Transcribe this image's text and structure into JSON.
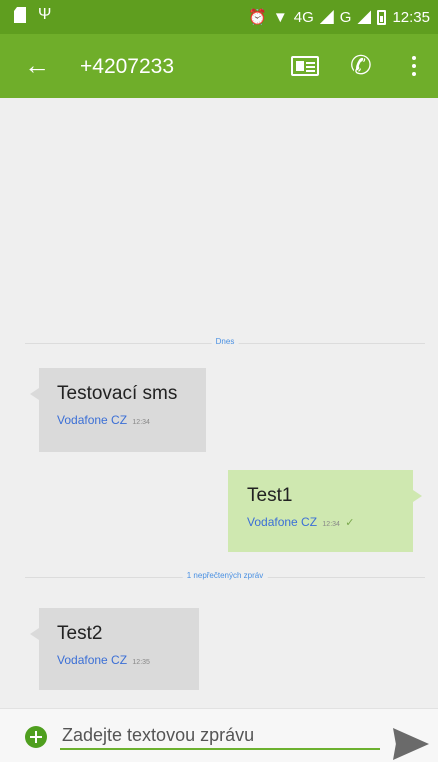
{
  "status_bar": {
    "time": "12:35",
    "network_1": "4G",
    "network_2": "G",
    "icons": [
      "sim-card-icon",
      "usb-icon",
      "alarm-icon",
      "wifi-icon",
      "signal-icon",
      "battery-icon"
    ]
  },
  "toolbar": {
    "title": "+4207233",
    "icons": [
      "back-arrow-icon",
      "contact-card-icon",
      "phone-icon",
      "more-vert-icon"
    ],
    "back_glyph": "←",
    "phone_glyph": "✆"
  },
  "conversation": {
    "date_divider": "Dnes",
    "unread_divider": "1 nepřečtených zpráv",
    "messages": [
      {
        "direction": "incoming",
        "text": "Testovací sms",
        "carrier": "Vodafone CZ",
        "time": "12:34"
      },
      {
        "direction": "outgoing",
        "text": "Test1",
        "carrier": "Vodafone CZ",
        "time": "12:34",
        "status_glyph": "✓"
      },
      {
        "direction": "incoming",
        "text": "Test2",
        "carrier": "Vodafone CZ",
        "time": "12:35"
      }
    ]
  },
  "compose": {
    "placeholder": "Zadejte textovou zprávu",
    "value": ""
  },
  "colors": {
    "status_bar": "#5f9e1f",
    "toolbar": "#6fae2a",
    "incoming_bubble": "#dadada",
    "outgoing_bubble": "#cfe8b0",
    "carrier_text": "#3b6fd6",
    "accent": "#4f9f1f"
  }
}
